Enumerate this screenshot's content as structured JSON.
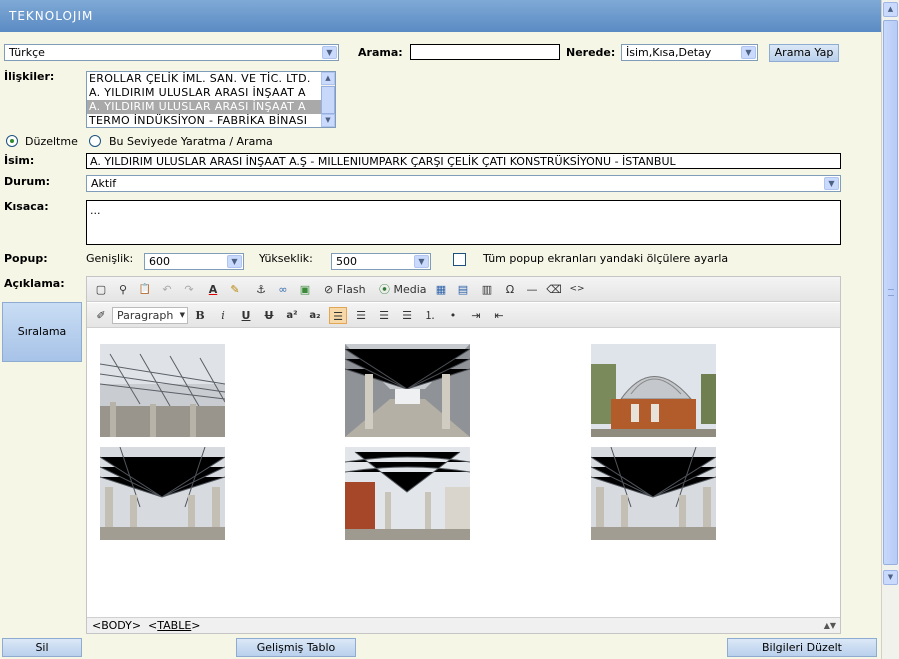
{
  "header": {
    "brand": "TEKNOLOJIM"
  },
  "search_bar": {
    "language_value": "Türkçe",
    "search_label": "Arama:",
    "search_value": "",
    "where_label": "Nerede:",
    "where_value": "İsim,Kısa,Detay",
    "search_button": "Arama Yap"
  },
  "relations": {
    "label": "İlişkiler:",
    "items": [
      "EROLLAR ÇELİK İML. SAN. VE TİC. LTD.",
      "A. YILDIRIM ULUSLAR ARASI İNŞAAT A",
      "A. YILDIRIM ULUSLAR ARASI İNŞAAT A",
      "TERMO İNDÜKSİYON - FABRİKA BİNASI"
    ],
    "selected_index": 2
  },
  "mode": {
    "edit_label": "Düzeltme",
    "create_label": "Bu Seviyede Yaratma / Arama",
    "selected": "edit"
  },
  "form": {
    "name_label": "İsim:",
    "name_value": "A. YILDIRIM ULUSLAR ARASI İNŞAAT A.Ş - MILLENIUMPARK ÇARŞI ÇELİK ÇATI KONSTRÜKSİYONU - İSTANBUL",
    "status_label": "Durum:",
    "status_value": "Aktif",
    "short_label": "Kısaca:",
    "short_value": "...",
    "popup_label": "Popup:",
    "width_label": "Genişlik:",
    "width_value": "600",
    "height_label": "Yükseklik:",
    "height_value": "500",
    "all_popups_label": "Tüm popup ekranları yandaki ölçülere ayarla",
    "all_popups_checked": false,
    "description_label": "Açıklama:"
  },
  "side_buttons": {
    "sort_label": "Sıralama"
  },
  "editor": {
    "toolbar1": [
      {
        "name": "fullscreen-icon",
        "glyph": "▢"
      },
      {
        "name": "find-icon",
        "glyph": "⚲"
      },
      {
        "name": "paste-icon",
        "glyph": "📋"
      },
      {
        "name": "undo-icon",
        "glyph": "↶"
      },
      {
        "name": "redo-icon",
        "glyph": "↷"
      },
      {
        "name": "text-color-icon",
        "glyph": "A"
      },
      {
        "name": "highlight-icon",
        "glyph": "✎"
      },
      {
        "name": "anchor-icon",
        "glyph": "⚓"
      },
      {
        "name": "link-icon",
        "glyph": "∞"
      },
      {
        "name": "image-icon",
        "glyph": "▣"
      }
    ],
    "flash_label": "Flash",
    "media_label": "Media",
    "toolbar1b": [
      {
        "name": "table-icon",
        "glyph": "▦"
      },
      {
        "name": "table-edit-icon",
        "glyph": "▤"
      },
      {
        "name": "layer-icon",
        "glyph": "▥"
      },
      {
        "name": "special-char-icon",
        "glyph": "Ω"
      },
      {
        "name": "horizontal-rule-icon",
        "glyph": "—"
      },
      {
        "name": "eraser-icon",
        "glyph": "⌫"
      },
      {
        "name": "source-icon",
        "glyph": "<>"
      }
    ],
    "format_value": "Paragraph",
    "toolbar2": [
      {
        "name": "bold-icon",
        "glyph": "B"
      },
      {
        "name": "italic-icon",
        "glyph": "i"
      },
      {
        "name": "underline-icon",
        "glyph": "U"
      },
      {
        "name": "strikethrough-icon",
        "glyph": "U"
      },
      {
        "name": "superscript-icon",
        "glyph": "a²"
      },
      {
        "name": "subscript-icon",
        "glyph": "a₂"
      },
      {
        "name": "align-left-icon",
        "glyph": "☰"
      },
      {
        "name": "align-center-icon",
        "glyph": "☰"
      },
      {
        "name": "align-right-icon",
        "glyph": "☰"
      },
      {
        "name": "justify-icon",
        "glyph": "☰"
      },
      {
        "name": "ordered-list-icon",
        "glyph": "⒈"
      },
      {
        "name": "unordered-list-icon",
        "glyph": "•"
      },
      {
        "name": "indent-icon",
        "glyph": "⇥"
      },
      {
        "name": "outdent-icon",
        "glyph": "⇤"
      }
    ],
    "images": [
      "roof-truss-photo-1",
      "roof-truss-photo-2",
      "dome-building-photo",
      "roof-truss-photo-3",
      "roof-truss-photo-4",
      "roof-truss-photo-5"
    ],
    "status_body": "<BODY>",
    "status_table": "TABLE"
  },
  "bottom_buttons": {
    "delete_label": "Sil",
    "advanced_table_label": "Gelişmiş Tablo",
    "update_label": "Bilgileri Düzelt"
  }
}
